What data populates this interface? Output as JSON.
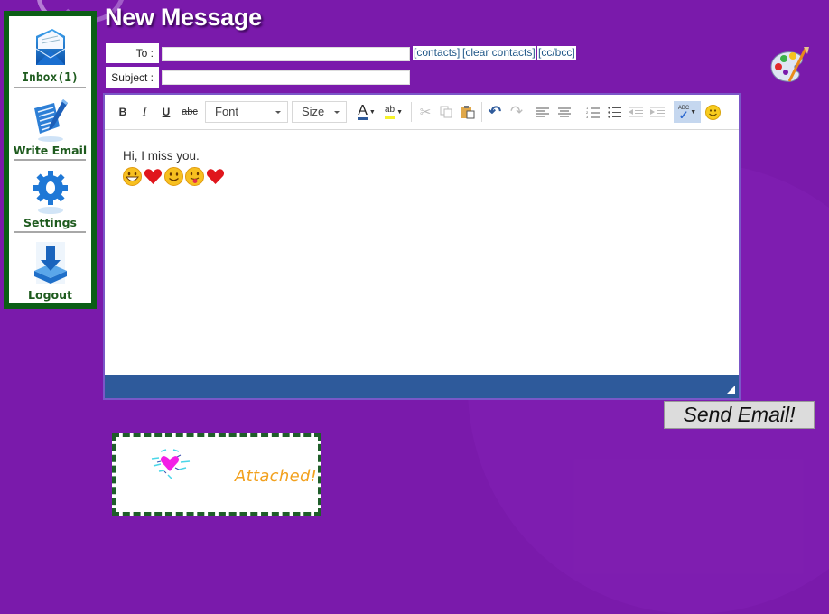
{
  "page": {
    "title": "New Message"
  },
  "sidebar": {
    "items": [
      {
        "label": "Inbox(1)",
        "icon": "envelope-icon"
      },
      {
        "label": "Write Email",
        "icon": "pen-note-icon"
      },
      {
        "label": "Settings",
        "icon": "gear-icon"
      },
      {
        "label": "Logout",
        "icon": "download-arrow-icon"
      }
    ]
  },
  "compose": {
    "to_label": "To :",
    "to_value": "",
    "subject_label": "Subject :",
    "subject_value": "",
    "links": {
      "contacts": "[contacts]",
      "clear_contacts": "[clear contacts]",
      "cc_bcc": "[cc/bcc]"
    }
  },
  "toolbar": {
    "bold": "B",
    "italic": "I",
    "underline": "U",
    "strike": "abc",
    "font_select": "Font",
    "size_select": "Size",
    "text_color": "A",
    "highlight": "ab",
    "spellcheck": "ABC"
  },
  "editor": {
    "body_text": "Hi, I miss you.",
    "emoticons": [
      "big-grin",
      "heart",
      "smile",
      "tongue-out",
      "heart"
    ]
  },
  "actions": {
    "send_label": "Send Email!"
  },
  "attachment": {
    "label": "Attached!"
  },
  "colors": {
    "background": "#7a1aab",
    "sidebar_border": "#0b5e16",
    "sidebar_label": "#1e5b1e",
    "editor_status_bar": "#2e5a9b",
    "attached_text": "#f2a11e",
    "link_text": "#245a8a"
  }
}
